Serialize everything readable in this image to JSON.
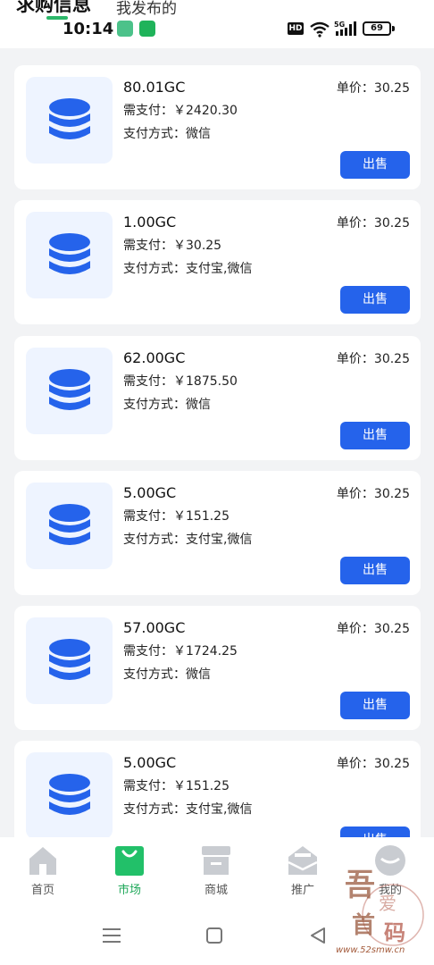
{
  "header": {
    "tab_active": "求购信息",
    "tab_mine": "我发布的"
  },
  "status_bar": {
    "time": "10:14",
    "hd": "HD",
    "battery": "69",
    "network": "5G"
  },
  "listings": [
    {
      "amount": "80.01GC",
      "need_pay": "需支付：￥2420.30",
      "pay_method": "支付方式：微信",
      "unit_price": "单价：30.25",
      "sell_label": "出售"
    },
    {
      "amount": "1.00GC",
      "need_pay": "需支付：￥30.25",
      "pay_method": "支付方式：支付宝,微信",
      "unit_price": "单价：30.25",
      "sell_label": "出售"
    },
    {
      "amount": "62.00GC",
      "need_pay": "需支付：￥1875.50",
      "pay_method": "支付方式：微信",
      "unit_price": "单价：30.25",
      "sell_label": "出售"
    },
    {
      "amount": "5.00GC",
      "need_pay": "需支付：￥151.25",
      "pay_method": "支付方式：支付宝,微信",
      "unit_price": "单价：30.25",
      "sell_label": "出售"
    },
    {
      "amount": "57.00GC",
      "need_pay": "需支付：￥1724.25",
      "pay_method": "支付方式：微信",
      "unit_price": "单价：30.25",
      "sell_label": "出售"
    },
    {
      "amount": "5.00GC",
      "need_pay": "需支付：￥151.25",
      "pay_method": "支付方式：支付宝,微信",
      "unit_price": "单价：30.25",
      "sell_label": "出售"
    }
  ],
  "bottom_nav": {
    "home": "首页",
    "market": "市场",
    "mall": "商城",
    "promote": "推广",
    "mine": "我的",
    "active": "market"
  },
  "colors": {
    "accent_blue": "#2563eb",
    "accent_green": "#1fa85a",
    "icon_gray": "#c9ccd1"
  },
  "watermark": {
    "text": "吾爱首码",
    "url": "www.52smw.cn"
  }
}
